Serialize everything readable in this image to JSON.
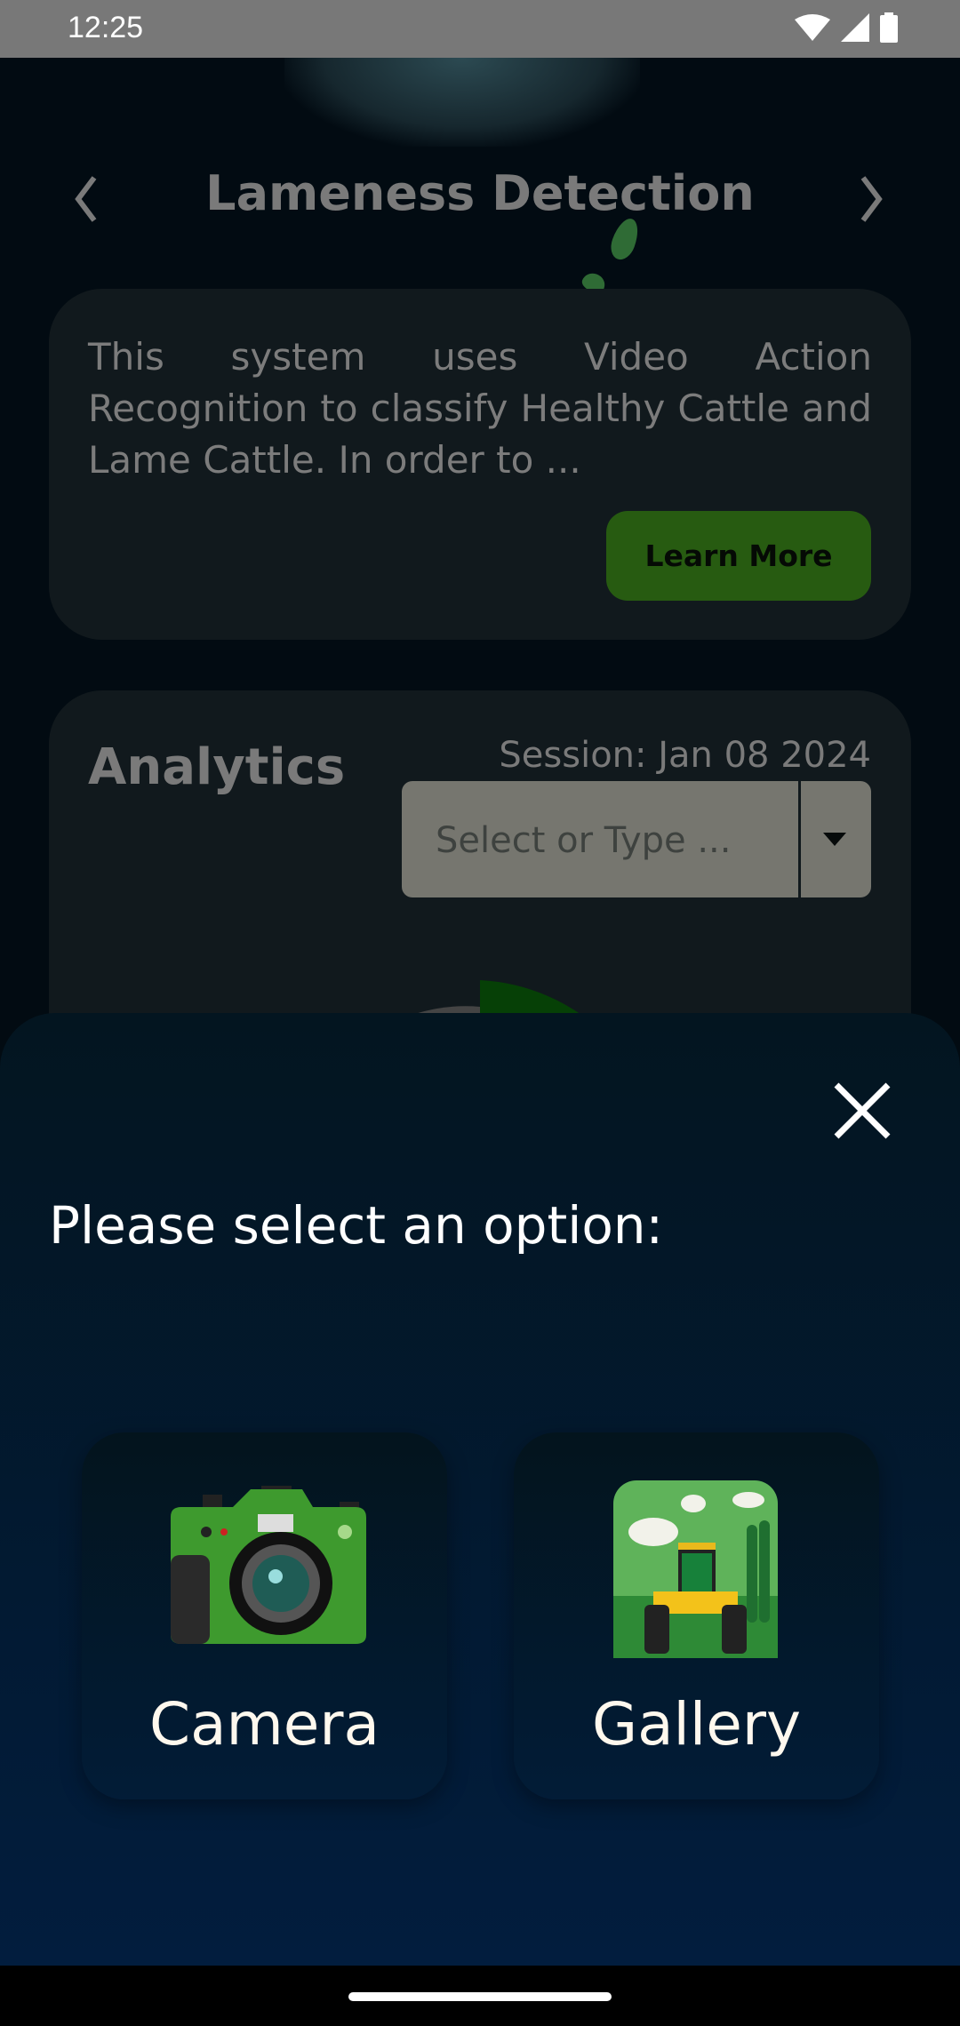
{
  "status_bar": {
    "time": "12:25",
    "icons": [
      "wifi-icon",
      "signal-icon",
      "battery-icon"
    ]
  },
  "header": {
    "title": "Lameness Detection",
    "prev_icon": "chevron-left-icon",
    "next_icon": "chevron-right-icon"
  },
  "info_card": {
    "description": "This system uses Video Action Recognition to classify Healthy Cattle and Lame Cattle. In order to ...",
    "learn_more_label": "Learn More",
    "button_color": "#275b11"
  },
  "analytics": {
    "title": "Analytics",
    "session": "Session: Jan 08 2024",
    "dropdown_placeholder": "Select or Type ..."
  },
  "bottom_sheet": {
    "prompt": "Please select an option:",
    "close_icon": "close-icon",
    "options": [
      {
        "label": "Camera",
        "icon": "camera-icon"
      },
      {
        "label": "Gallery",
        "icon": "gallery-tractor-icon"
      }
    ]
  }
}
